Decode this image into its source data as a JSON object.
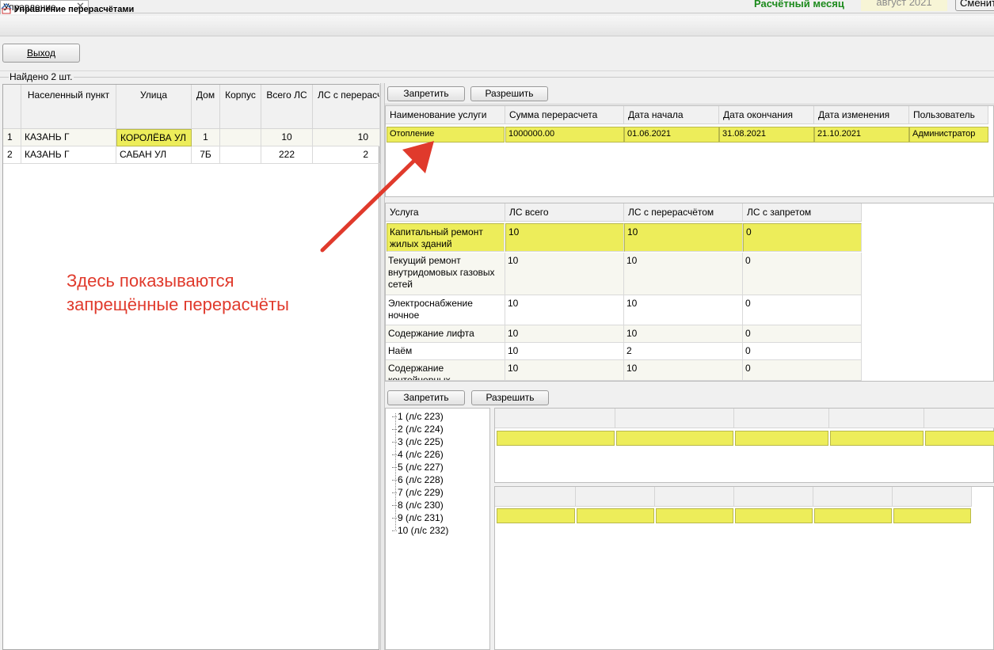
{
  "top_bar": {
    "tab_label": "Управление",
    "tab_close": "✕",
    "month_label": "Расчётный месяц",
    "month_value": "август 2021",
    "change_button": "Сменить"
  },
  "title_bar": {
    "title": "Управление перерасчётами",
    "icon": "app-logo-icon"
  },
  "exit_button": "Выход",
  "found_label": "Найдено 2 шт.",
  "houses_table": {
    "columns": [
      "Населенный пункт",
      "Улица",
      "Дом",
      "Корпус",
      "Всего ЛС",
      "ЛС с перерасчётом"
    ],
    "rows": [
      {
        "num": "1",
        "city": "КАЗАНЬ Г",
        "street": "КОРОЛЁВА УЛ",
        "house": "1",
        "building": "",
        "total_ls": "10",
        "ls_recalc": "10"
      },
      {
        "num": "2",
        "city": "КАЗАНЬ Г",
        "street": "САБАН УЛ",
        "house": "7Б",
        "building": "",
        "total_ls": "222",
        "ls_recalc": "2"
      }
    ]
  },
  "toolbar_top": {
    "forbid": "Запретить",
    "allow": "Разрешить"
  },
  "recalc_table": {
    "columns": [
      "Наименование услуги",
      "Сумма перерасчета",
      "Дата начала",
      "Дата окончания",
      "Дата изменения",
      "Пользователь"
    ],
    "rows": [
      [
        "Отопление",
        "1000000.00",
        "01.06.2021",
        "31.08.2021",
        "21.10.2021",
        "Администратор"
      ]
    ]
  },
  "services_table": {
    "columns": [
      "Услуга",
      "ЛС всего",
      "ЛС с перерасчётом",
      "ЛС с запретом"
    ],
    "rows": [
      [
        "Капитальный ремонт жилых зданий",
        "10",
        "10",
        "0"
      ],
      [
        "Текущий ремонт внутридомовых газовых сетей",
        "10",
        "10",
        "0"
      ],
      [
        "Электроснабжение ночное",
        "10",
        "10",
        "0"
      ],
      [
        "Содержание лифта",
        "10",
        "10",
        "0"
      ],
      [
        "Наём",
        "10",
        "2",
        "0"
      ],
      [
        "Содержание контейнерных",
        "10",
        "10",
        "0"
      ]
    ]
  },
  "toolbar_bottom": {
    "forbid": "Запретить",
    "allow": "Разрешить"
  },
  "ls_tree": [
    "1 (л/с 223)",
    "2 (л/с 224)",
    "3 (л/с 225)",
    "4 (л/с 226)",
    "5 (л/с 227)",
    "6 (л/с 228)",
    "7 (л/с 229)",
    "8 (л/с 230)",
    "9 (л/с 231)",
    "10 (л/с 232)"
  ],
  "annotation": {
    "line1": "Здесь показываются",
    "line2": "запрещённые перерасчёты",
    "color": "#e03a2c"
  },
  "colors": {
    "selection": "#eded5a",
    "month_label": "#1c8a1c"
  }
}
